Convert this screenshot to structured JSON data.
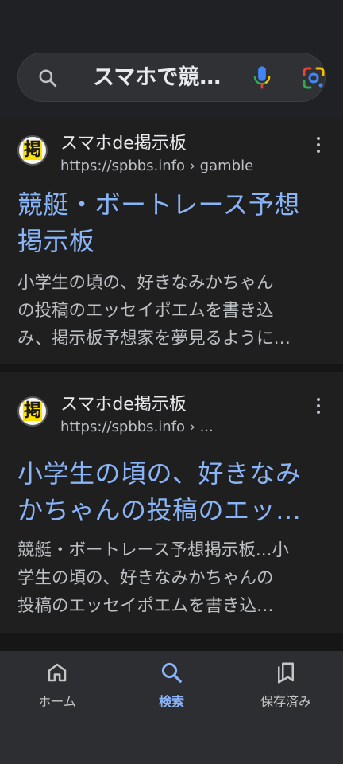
{
  "search": {
    "query": "スマホで競…"
  },
  "results": [
    {
      "favicon_char": "掲",
      "site_name": "スマホde掲示板",
      "site_url": "https://spbbs.info › gamble",
      "title_lines": [
        "競艇・ボートレース予想",
        "掲示板"
      ],
      "snippet_lines": [
        "小学生の頃の、好きなみかちゃん",
        "の投稿のエッセイポエムを書き込",
        "み、掲示板予想家を夢見るように…"
      ]
    },
    {
      "favicon_char": "掲",
      "site_name": "スマホde掲示板",
      "site_url": "https://spbbs.info › ...",
      "title_lines": [
        "小学生の頃の、好きなみ",
        "かちゃんの投稿のエッ…"
      ],
      "snippet_lines": [
        "競艇・ボートレース予想掲示板...小",
        "学生の頃の、好きなみかちゃんの",
        "投稿のエッセイポエムを書き込…"
      ]
    }
  ],
  "bottom_nav": [
    {
      "label": "ホーム",
      "icon": "home-icon"
    },
    {
      "label": "検索",
      "icon": "search-icon"
    },
    {
      "label": "保存済み",
      "icon": "saved-icon"
    }
  ],
  "colors": {
    "link": "#8ab4f8",
    "background": "#1f1f1f",
    "active_nav": "#8ab4f8"
  }
}
